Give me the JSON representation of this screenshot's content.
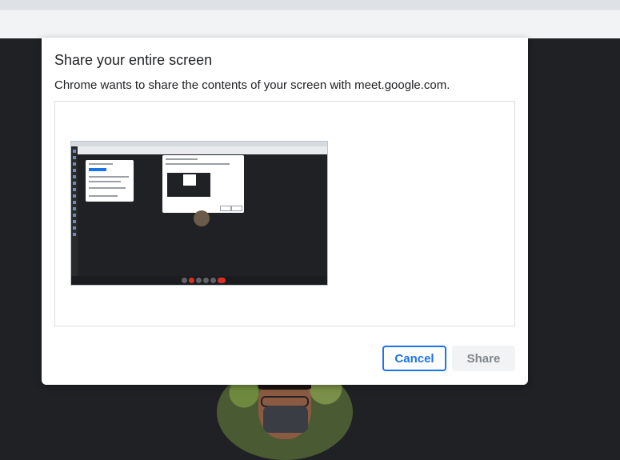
{
  "dialog": {
    "title": "Share your entire screen",
    "description": "Chrome wants to share the contents of your screen with meet.google.com."
  },
  "buttons": {
    "cancel": "Cancel",
    "share": "Share"
  },
  "colors": {
    "accent": "#1a73e8",
    "background": "#202124",
    "dialog": "#ffffff",
    "share_disabled_bg": "#f1f3f4",
    "share_disabled_text": "#80868b"
  }
}
